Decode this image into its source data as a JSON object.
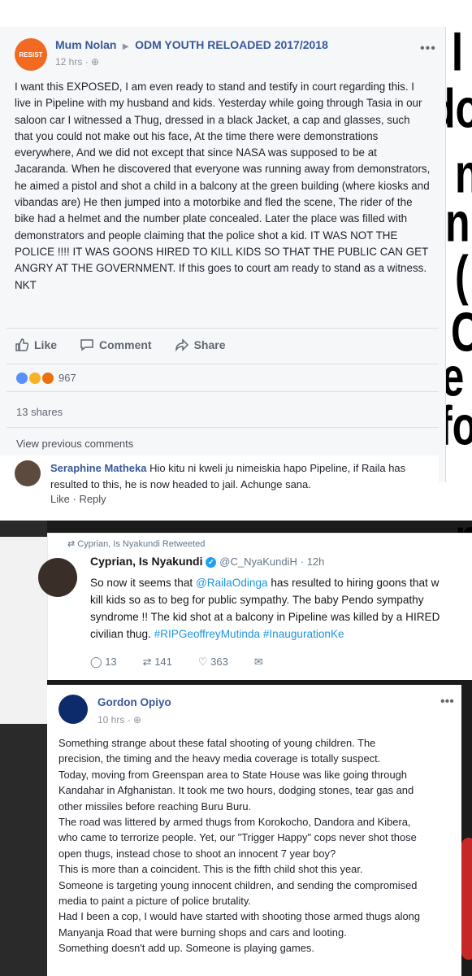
{
  "background_letters": [
    "I",
    "do",
    "n",
    "n",
    "(",
    "C",
    "de",
    "fo",
    "n"
  ],
  "post1": {
    "avatar_label": "RESIST",
    "author": "Mum Nolan",
    "group": "ODM YOUTH RELOADED 2017/2018",
    "time": "12 hrs",
    "text": "I want this EXPOSED, I am even ready to stand and testify in court regarding this. I live in Pipeline with my husband and kids. Yesterday while going through Tasia in our saloon car I witnessed a Thug, dressed in a black Jacket, a cap and glasses, such that you could not make out his face, At the time there were demonstrations everywhere, And we did not except that since NASA was supposed to be at Jacaranda. When he discovered that everyone was running away from demonstrators, he aimed a pistol and shot a child in a balcony at the green building (where kiosks and vibandas are) He then jumped into a motorbike and fled the scene, The rider of the bike had a helmet and the number plate concealed. Later the place was filled with demonstrators and people claiming that the police shot a kid. IT WAS NOT THE POLICE !!!! IT WAS GOONS HIRED TO KILL KIDS SO THAT THE PUBLIC CAN GET ANGRY AT THE GOVERNMENT. If this goes to court am ready to stand as a witness. NKT",
    "like": "Like",
    "comment": "Comment",
    "share": "Share",
    "reactions": "967",
    "shares": "13 shares",
    "view_previous": "View previous comments"
  },
  "comment1": {
    "author": "Seraphine Matheka",
    "text": "Hio kitu ni kweli ju nimeiskia hapo Pipeline, if Raila has resulted to this, he is now headed to jail. Achunge sana.",
    "like": "Like",
    "reply": "Reply"
  },
  "tweet": {
    "retweeted_by": "Cyprian, Is Nyakundi Retweeted",
    "name": "Cyprian, Is Nyakundi",
    "handle": "@C_NyaKundiH",
    "time": "12h",
    "line1_pre": "So now it seems that ",
    "mention": "@RailaOdinga",
    "line1_post": " has resulted to hiring goons that w",
    "line2": "kill kids so as to beg for public sympathy. The baby Pendo sympathy",
    "line3": "syndrome !! The kid shot at a balcony in Pipeline was killed by a HIRED",
    "line4_pre": "civilian thug. ",
    "hashtags": "#RIPGeoffreyMutinda #InaugurationKe",
    "replies": "13",
    "retweets": "141",
    "likes": "363"
  },
  "post2": {
    "author": "Gordon Opiyo",
    "time": "10 hrs",
    "text_lines": [
      "Something strange about these fatal shooting of young children. The",
      "precision, the timing and the heavy media coverage is totally suspect.",
      "Today, moving from Greenspan area to State House was like going through",
      "Kandahar in Afghanistan. It took me two hours, dodging stones, tear gas and",
      "other missiles before reaching Buru Buru.",
      "The road was littered by armed thugs from Korokocho, Dandora and Kibera,",
      "who came to terrorize people. Yet, our \"Trigger Happy\" cops never shot those",
      "open thugs, instead chose to shoot an innocent 7 year boy?",
      "This is more than a coincident. This is the fifth child shot this year.",
      "Someone is targeting young innocent children, and sending the compromised",
      "media to paint a picture of police brutality.",
      "Had I been a cop, I would have started with shooting those armed thugs along",
      "Manyanja Road that were burning shops and cars and looting.",
      "Something doesn't add up. Someone is playing games."
    ]
  }
}
